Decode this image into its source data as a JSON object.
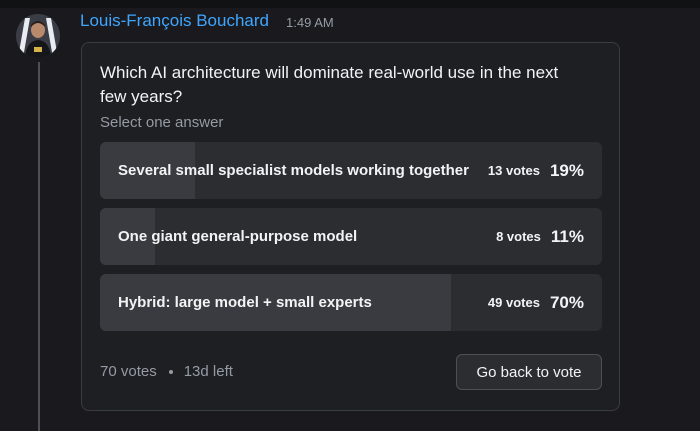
{
  "message": {
    "author": "Louis-François Bouchard",
    "timestamp": "1:49 AM"
  },
  "poll": {
    "question": "Which AI architecture will dominate real-world use in the next few years?",
    "hint": "Select one answer",
    "answers": [
      {
        "label": "Several small specialist models working together",
        "votes": "13 votes",
        "percent": "19%",
        "fraction": 0.19
      },
      {
        "label": "One giant general-purpose model",
        "votes": "8 votes",
        "percent": "11%",
        "fraction": 0.11
      },
      {
        "label": "Hybrid: large model + small experts",
        "votes": "49 votes",
        "percent": "70%",
        "fraction": 0.7
      }
    ],
    "total_votes": "70 votes",
    "time_left": "13d left",
    "button_label": "Go back to vote"
  },
  "colors": {
    "author": "#3ea6ff",
    "fill": "#3a3b40",
    "answer_bg": "#2b2d31",
    "card_bg": "#1e1f22"
  }
}
